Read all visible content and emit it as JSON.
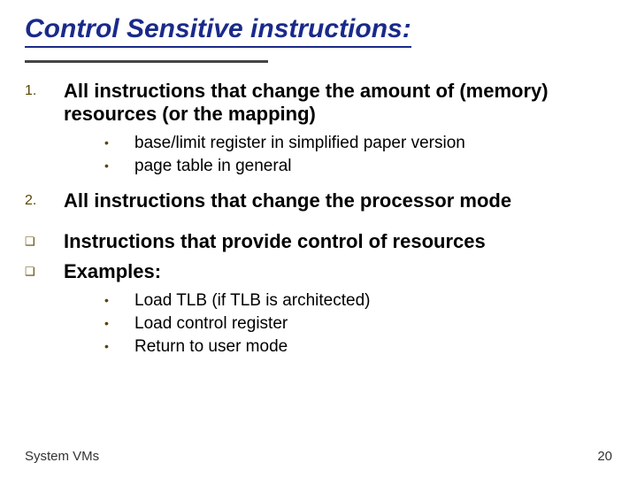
{
  "title": "Control Sensitive instructions:",
  "items": [
    {
      "marker": "1.",
      "text": "All instructions that change the amount of (memory) resources (or the mapping)",
      "sub": [
        "base/limit register in simplified paper version",
        "page table in general"
      ]
    },
    {
      "marker": "2.",
      "text": "All instructions that change the processor mode",
      "sub": []
    }
  ],
  "notes": [
    {
      "marker": "❑",
      "text": "Instructions that provide control of  resources"
    },
    {
      "marker": "❑",
      "text": "Examples:",
      "sub": [
        "Load TLB (if TLB is architected)",
        "Load control register",
        "Return to user mode"
      ]
    }
  ],
  "footer": {
    "left": "System VMs",
    "right": "20"
  }
}
